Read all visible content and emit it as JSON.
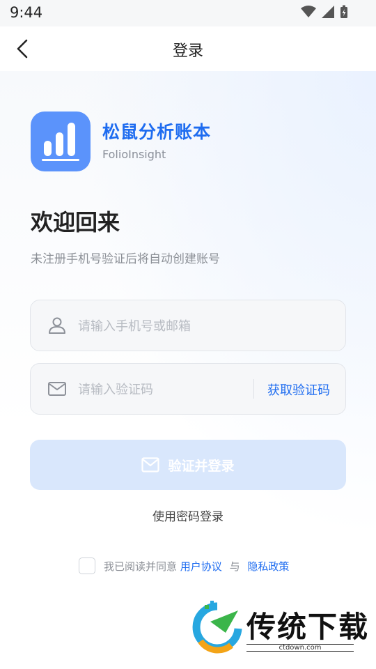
{
  "status_bar": {
    "time": "9:44"
  },
  "nav": {
    "title": "登录"
  },
  "brand": {
    "name": "松鼠分析账本",
    "subtitle": "FolioInsight"
  },
  "welcome": {
    "title": "欢迎回来",
    "hint": "未注册手机号验证后将自动创建账号"
  },
  "phone_field": {
    "placeholder": "请输入手机号或邮箱",
    "value": ""
  },
  "code_field": {
    "placeholder": "请输入验证码",
    "value": "",
    "get_code_label": "获取验证码"
  },
  "login_button": {
    "label": "验证并登录"
  },
  "password_login": {
    "label": "使用密码登录"
  },
  "agreement": {
    "prefix": "我已阅读并同意",
    "user_agreement": "用户协议",
    "and": "与",
    "privacy_policy": "隐私政策",
    "checked": false
  },
  "watermark": {
    "title": "传统下载",
    "url": "ctdown.com"
  },
  "colors": {
    "accent": "#1e6cf0",
    "logo_bg": "#5b93fb",
    "button_disabled_bg": "#d9e7fc"
  }
}
